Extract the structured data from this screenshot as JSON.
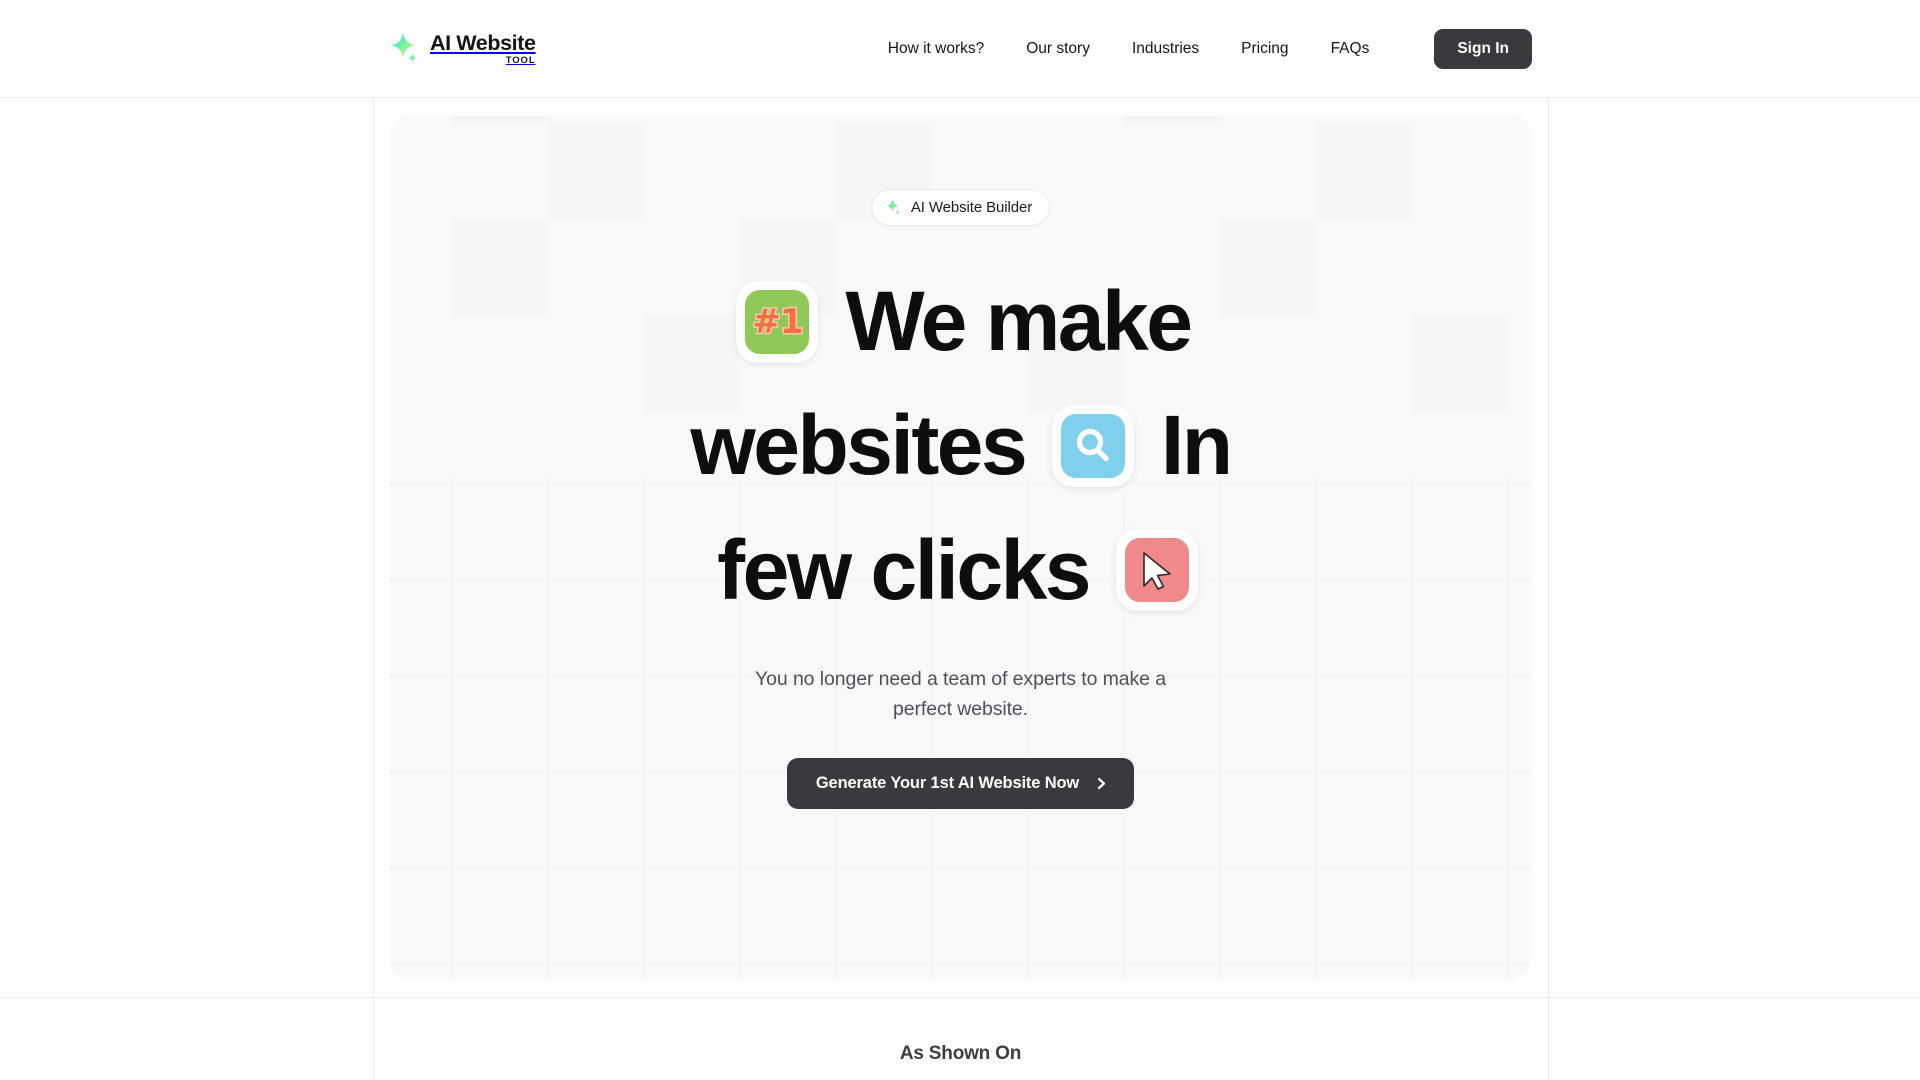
{
  "brand": {
    "logo_title": "AI Website",
    "logo_subtitle": "TOOL",
    "logo_icon": "sparkle-gradient-icon",
    "gradient_start": "#4fe3e0",
    "gradient_end": "#d6f24a"
  },
  "header": {
    "nav": [
      {
        "label": "How it works?",
        "name": "nav-how-it-works"
      },
      {
        "label": "Our story",
        "name": "nav-our-story"
      },
      {
        "label": "Industries",
        "name": "nav-industries"
      },
      {
        "label": "Pricing",
        "name": "nav-pricing"
      },
      {
        "label": "FAQs",
        "name": "nav-faqs"
      }
    ],
    "sign_in_label": "Sign In",
    "sign_in_color": "#3a3a3e"
  },
  "hero": {
    "badge": {
      "label": "AI Website Builder",
      "icon": "sparkle-gradient-icon"
    },
    "headline": {
      "line1_text": "We make",
      "line2_text_a": "websites",
      "line2_text_b": "In",
      "line3_text": "few clicks",
      "tile1_glyph": "#1",
      "tile1_icon": "number-one-badge-icon",
      "tile1_color": "#8fc856",
      "tile2_icon": "magnifier-icon",
      "tile2_color": "#7fd0ec",
      "tile3_icon": "cursor-arrow-icon",
      "tile3_color": "#f08a8a"
    },
    "subtitle": "You no longer need a team of experts to make a perfect website.",
    "cta_label": "Generate Your 1st AI Website Now",
    "cta_icon": "chevron-right-icon",
    "cta_color": "#3a3a3e",
    "background_color": "#f9f9fa"
  },
  "below": {
    "as_shown_on_title": "As Shown On"
  }
}
